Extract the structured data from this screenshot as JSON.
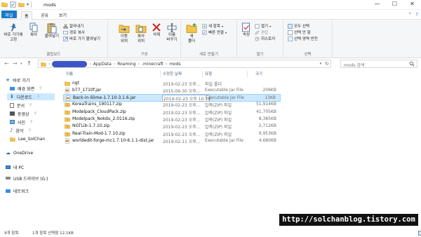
{
  "window": {
    "title": "mods",
    "buttons": {
      "minimize": "—",
      "maximize": "☐",
      "close": "✕"
    }
  },
  "ribbon_tabs": [
    {
      "label": "파일",
      "active": false,
      "file": true
    },
    {
      "label": "홈",
      "active": true
    },
    {
      "label": "공유",
      "active": false
    },
    {
      "label": "보기",
      "active": false
    }
  ],
  "ribbon": {
    "groups": {
      "clipboard": {
        "name": "클립보드",
        "pin_label_1": "바로 가기에",
        "pin_label_2": "고정",
        "copy": "복사",
        "paste": "붙여넣기",
        "cut": "잘라내기",
        "copy_path": "경로 복사",
        "paste_shortcut": "바로 가기 붙여넣기"
      },
      "organize": {
        "name": "구성",
        "move_1": "이동",
        "move_2": "위치",
        "copy_1": "복사",
        "copy_2": "위치",
        "delete": "삭제",
        "rename_1": "이름",
        "rename_2": "바꾸기"
      },
      "new": {
        "name": "새로 만들기",
        "new_folder_1": "새",
        "new_folder_2": "폴더",
        "new_item": "새 항목",
        "easy_access": "빠른 연결"
      },
      "open": {
        "name": "열기",
        "properties": "속성",
        "open": "열기",
        "edit": "편집",
        "history": "히스토리"
      },
      "select": {
        "name": "선택",
        "select_all": "모두 선택",
        "select_none": "선택 안 함",
        "invert": "선택 영역 반전"
      }
    }
  },
  "address": {
    "crumbs": [
      "AppData",
      "Roaming",
      ".minecraft",
      "mods"
    ],
    "search_placeholder": "mods 검색"
  },
  "nav": {
    "quick_access": "바로 가기",
    "items": [
      {
        "label": "배경 화면",
        "icon": "desktop-icon",
        "pinned": true
      },
      {
        "label": "다운로드",
        "icon": "download-icon",
        "pinned": true,
        "selected": true
      },
      {
        "label": "문서",
        "icon": "document-icon",
        "pinned": true
      },
      {
        "label": "동영상",
        "icon": "video-icon",
        "pinned": true
      },
      {
        "label": "사진",
        "icon": "picture-icon",
        "pinned": true
      },
      {
        "label": "음악",
        "icon": "music-icon",
        "pinned": true
      },
      {
        "label": "Lee_SolChan",
        "icon": "folder-icon",
        "pinned": false
      }
    ],
    "onedrive": "OneDrive",
    "thispc": "내 PC",
    "usb": "USB 드라이브 (G:)",
    "network": "네트워크"
  },
  "columns": {
    "name": "이름",
    "date": "수정한 날짜",
    "type": "유형",
    "size": "크기"
  },
  "files": [
    {
      "name": "ngt",
      "date": "2019-02-23 오후...",
      "type": "파일 폴더",
      "size": "",
      "kind": "folder"
    },
    {
      "name": "b77_1710f.jar",
      "date": "2015-09-30 오후...",
      "type": "Executable Jar File",
      "size": "206KB",
      "kind": "jar"
    },
    {
      "name": "Back-in-Slime-1.7.10-3.1.6.jar",
      "date": "2019-02-23 오후 10:18",
      "type": "Executable Jar File",
      "size": "13KB",
      "kind": "jar",
      "selected": true
    },
    {
      "name": "KoreaTrains_190117.zip",
      "date": "2019-02-23 오후...",
      "type": "압축(ZIP) 파일",
      "size": "51,914KB",
      "kind": "zip"
    },
    {
      "name": "Modelpack_CloudPack.zip",
      "date": "2019-02-23 오후...",
      "type": "압축(ZIP) 파일",
      "size": "41,705KB",
      "kind": "zip"
    },
    {
      "name": "Modelpack_Nokdu_2.0116.zip",
      "date": "2019-02-23 오후...",
      "type": "압축(ZIP) 파일",
      "size": "8,385KB",
      "kind": "zip"
    },
    {
      "name": "NGTLib-1.7.10.zip",
      "date": "2019-02-23 오후...",
      "type": "압축(ZIP) 파일",
      "size": "2,712KB",
      "kind": "zip"
    },
    {
      "name": "Real-Train-Mod-1.7.10.zip",
      "date": "2019-02-23 오후...",
      "type": "압축(ZIP) 파일",
      "size": "9,953KB",
      "kind": "zip"
    },
    {
      "name": "worldedit-forge-mc1.7.10-6.1.1-dist.jar",
      "date": "2019-02-11 오후...",
      "type": "Executable Jar File",
      "size": "4,680KB",
      "kind": "jar"
    }
  ],
  "status": {
    "count": "9개 항목",
    "selection": "1개 항목 선택함 12.1KB"
  },
  "watermark": "http://solchanblog.tistory.com",
  "colors": {
    "accent": "#1979ca",
    "selection": "#cce8ff",
    "folder": "#f6c34b",
    "blurred_crumb": "#3c56c8"
  }
}
